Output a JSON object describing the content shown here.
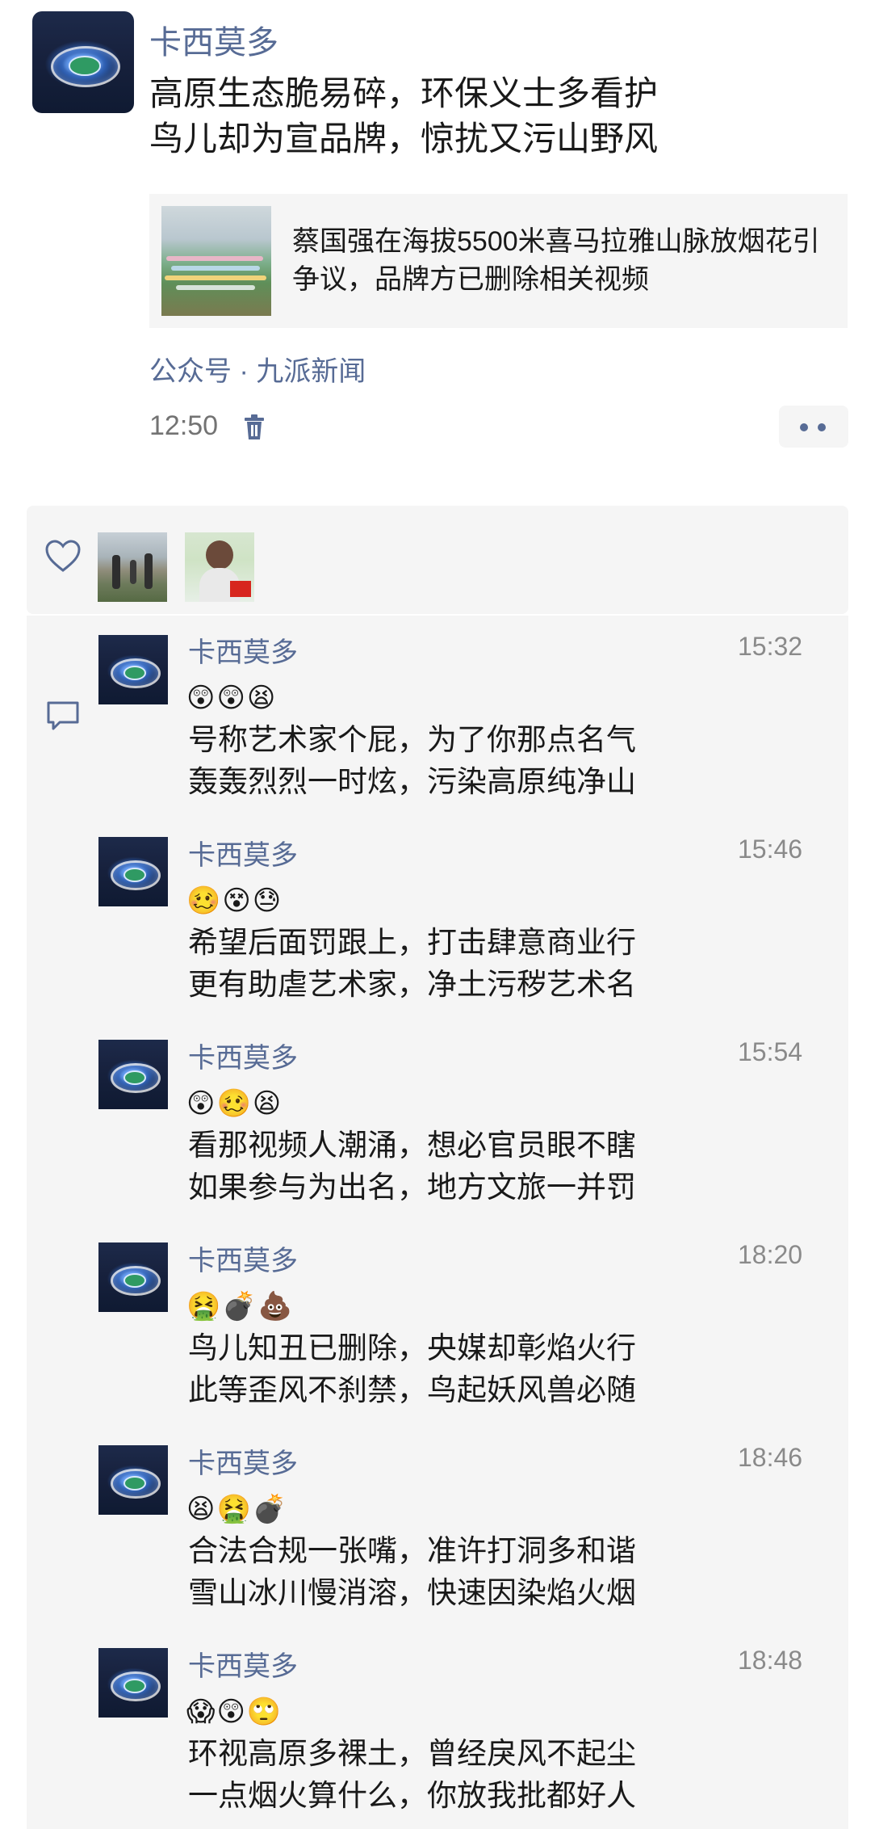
{
  "post": {
    "author": "卡西莫多",
    "text_line1": "高原生态脆易碎，环保义士多看护",
    "text_line2": "鸟儿却为宣品牌，惊扰又污山野风",
    "link_title": "蔡国强在海拔5500米喜马拉雅山脉放烟花引争议，品牌方已删除相关视频",
    "source": "公众号 · 九派新闻",
    "time": "12:50"
  },
  "likes": {
    "icons": [
      "heart-icon"
    ]
  },
  "comments": [
    {
      "name": "卡西莫多",
      "time": "15:32",
      "emojis": "😲😲😫",
      "line1": "号称艺术家个屁，为了你那点名气",
      "line2": "轰轰烈烈一时炫，污染高原纯净山"
    },
    {
      "name": "卡西莫多",
      "time": "15:46",
      "emojis": "🥴😵😓",
      "line1": "希望后面罚跟上，打击肆意商业行",
      "line2": "更有助虐艺术家，净土污秽艺术名"
    },
    {
      "name": "卡西莫多",
      "time": "15:54",
      "emojis": "😲🥴😫",
      "line1": "看那视频人潮涌，想必官员眼不瞎",
      "line2": "如果参与为出名，地方文旅一并罚"
    },
    {
      "name": "卡西莫多",
      "time": "18:20",
      "emojis": "🤮💣💩",
      "line1": "鸟儿知丑已删除，央媒却彰焰火行",
      "line2": "此等歪风不刹禁，鸟起妖风兽必随"
    },
    {
      "name": "卡西莫多",
      "time": "18:46",
      "emojis": "😫🤮💣",
      "line1": "合法合规一张嘴，准许打洞多和谐",
      "line2": "雪山冰川慢消溶，快速因染焰火烟"
    },
    {
      "name": "卡西莫多",
      "time": "18:48",
      "emojis": "😱😲🙄",
      "line1": "环视高原多裸土，曾经戾风不起尘",
      "line2": "一点烟火算什么，你放我批都好人"
    }
  ]
}
